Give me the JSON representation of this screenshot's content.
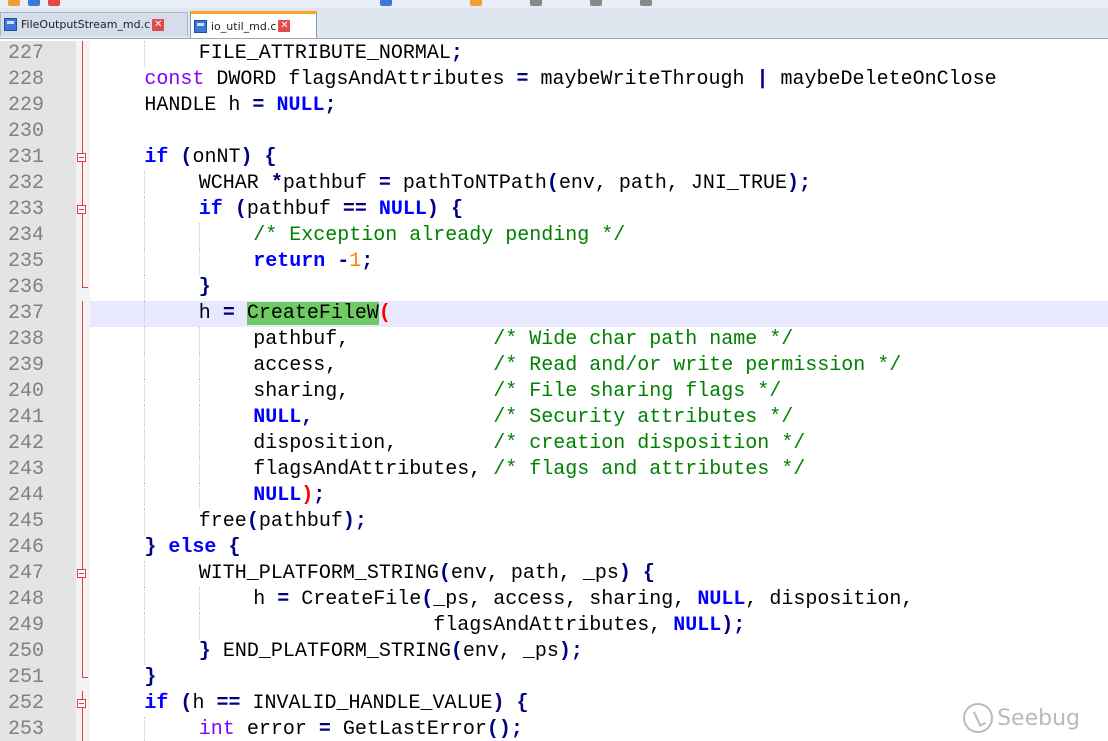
{
  "tabs": [
    {
      "label": "FileOutputStream_md.c",
      "active": false
    },
    {
      "label": "io_util_md.c",
      "active": true
    }
  ],
  "editor": {
    "highlight_line": "237",
    "lines": [
      {
        "num": "227",
        "fold": "bar",
        "indent": 4,
        "tokens": [
          {
            "t": "FILE_ATTRIBUTE_NORMAL",
            "c": "pl"
          },
          {
            "t": ";",
            "c": "op"
          }
        ]
      },
      {
        "num": "228",
        "fold": "bar",
        "indent": 2,
        "tokens": [
          {
            "t": "const",
            "c": "type"
          },
          {
            "t": " DWORD flagsAndAttributes ",
            "c": "pl"
          },
          {
            "t": "=",
            "c": "op"
          },
          {
            "t": " maybeWriteThrough ",
            "c": "pl"
          },
          {
            "t": "|",
            "c": "op"
          },
          {
            "t": " maybeDeleteOnClose",
            "c": "pl"
          }
        ]
      },
      {
        "num": "229",
        "fold": "bar",
        "indent": 2,
        "tokens": [
          {
            "t": "HANDLE h ",
            "c": "pl"
          },
          {
            "t": "=",
            "c": "op"
          },
          {
            "t": " ",
            "c": "pl"
          },
          {
            "t": "NULL",
            "c": "kw"
          },
          {
            "t": ";",
            "c": "op"
          }
        ]
      },
      {
        "num": "230",
        "fold": "bar",
        "indent": 0,
        "tokens": []
      },
      {
        "num": "231",
        "fold": "box",
        "indent": 2,
        "tokens": [
          {
            "t": "if",
            "c": "kw"
          },
          {
            "t": " ",
            "c": "pl"
          },
          {
            "t": "(",
            "c": "op"
          },
          {
            "t": "onNT",
            "c": "pl"
          },
          {
            "t": ")",
            "c": "op"
          },
          {
            "t": " ",
            "c": "pl"
          },
          {
            "t": "{",
            "c": "op"
          }
        ]
      },
      {
        "num": "232",
        "fold": "bar",
        "indent": 4,
        "tokens": [
          {
            "t": "WCHAR ",
            "c": "pl"
          },
          {
            "t": "*",
            "c": "op"
          },
          {
            "t": "pathbuf ",
            "c": "pl"
          },
          {
            "t": "=",
            "c": "op"
          },
          {
            "t": " pathToNTPath",
            "c": "pl"
          },
          {
            "t": "(",
            "c": "op"
          },
          {
            "t": "env, path, JNI_TRUE",
            "c": "pl"
          },
          {
            "t": ");",
            "c": "op"
          }
        ]
      },
      {
        "num": "233",
        "fold": "box",
        "indent": 4,
        "tokens": [
          {
            "t": "if",
            "c": "kw"
          },
          {
            "t": " ",
            "c": "pl"
          },
          {
            "t": "(",
            "c": "op"
          },
          {
            "t": "pathbuf ",
            "c": "pl"
          },
          {
            "t": "==",
            "c": "op"
          },
          {
            "t": " ",
            "c": "pl"
          },
          {
            "t": "NULL",
            "c": "kw"
          },
          {
            "t": ")",
            "c": "op"
          },
          {
            "t": " ",
            "c": "pl"
          },
          {
            "t": "{",
            "c": "op"
          }
        ]
      },
      {
        "num": "234",
        "fold": "bar",
        "indent": 6,
        "tokens": [
          {
            "t": "/* Exception already pending */",
            "c": "cm"
          }
        ]
      },
      {
        "num": "235",
        "fold": "bar",
        "indent": 6,
        "tokens": [
          {
            "t": "return",
            "c": "kw"
          },
          {
            "t": " ",
            "c": "pl"
          },
          {
            "t": "-",
            "c": "op"
          },
          {
            "t": "1",
            "c": "num"
          },
          {
            "t": ";",
            "c": "op"
          }
        ]
      },
      {
        "num": "236",
        "fold": "end",
        "indent": 4,
        "tokens": [
          {
            "t": "}",
            "c": "op"
          }
        ]
      },
      {
        "num": "237",
        "fold": "bar",
        "indent": 4,
        "tokens": [
          {
            "t": "h ",
            "c": "pl"
          },
          {
            "t": "=",
            "c": "op"
          },
          {
            "t": " ",
            "c": "pl"
          },
          {
            "t": "CreateFileW",
            "c": "match"
          },
          {
            "t": "(",
            "c": "red"
          }
        ]
      },
      {
        "num": "238",
        "fold": "bar",
        "indent": 6,
        "tokens": [
          {
            "t": "pathbuf,            ",
            "c": "pl"
          },
          {
            "t": "/* Wide char path name */",
            "c": "cm"
          }
        ]
      },
      {
        "num": "239",
        "fold": "bar",
        "indent": 6,
        "tokens": [
          {
            "t": "access,             ",
            "c": "pl"
          },
          {
            "t": "/* Read and/or write permission */",
            "c": "cm"
          }
        ]
      },
      {
        "num": "240",
        "fold": "bar",
        "indent": 6,
        "tokens": [
          {
            "t": "sharing,            ",
            "c": "pl"
          },
          {
            "t": "/* File sharing flags */",
            "c": "cm"
          }
        ]
      },
      {
        "num": "241",
        "fold": "bar",
        "indent": 6,
        "tokens": [
          {
            "t": "NULL",
            "c": "kw"
          },
          {
            "t": ",",
            "c": "op"
          },
          {
            "t": "               ",
            "c": "pl"
          },
          {
            "t": "/* Security attributes */",
            "c": "cm"
          }
        ]
      },
      {
        "num": "242",
        "fold": "bar",
        "indent": 6,
        "tokens": [
          {
            "t": "disposition,        ",
            "c": "pl"
          },
          {
            "t": "/* creation disposition */",
            "c": "cm"
          }
        ]
      },
      {
        "num": "243",
        "fold": "bar",
        "indent": 6,
        "tokens": [
          {
            "t": "flagsAndAttributes, ",
            "c": "pl"
          },
          {
            "t": "/* flags and attributes */",
            "c": "cm"
          }
        ]
      },
      {
        "num": "244",
        "fold": "bar",
        "indent": 6,
        "tokens": [
          {
            "t": "NULL",
            "c": "kw"
          },
          {
            "t": ")",
            "c": "red"
          },
          {
            "t": ";",
            "c": "op"
          }
        ]
      },
      {
        "num": "245",
        "fold": "bar",
        "indent": 4,
        "tokens": [
          {
            "t": "free",
            "c": "pl"
          },
          {
            "t": "(",
            "c": "op"
          },
          {
            "t": "pathbuf",
            "c": "pl"
          },
          {
            "t": ");",
            "c": "op"
          }
        ]
      },
      {
        "num": "246",
        "fold": "bar",
        "indent": 2,
        "tokens": [
          {
            "t": "}",
            "c": "op"
          },
          {
            "t": " ",
            "c": "pl"
          },
          {
            "t": "else",
            "c": "kw"
          },
          {
            "t": " ",
            "c": "pl"
          },
          {
            "t": "{",
            "c": "op"
          }
        ]
      },
      {
        "num": "247",
        "fold": "box",
        "indent": 4,
        "tokens": [
          {
            "t": "WITH_PLATFORM_STRING",
            "c": "pl"
          },
          {
            "t": "(",
            "c": "op"
          },
          {
            "t": "env, path, _ps",
            "c": "pl"
          },
          {
            "t": ")",
            "c": "op"
          },
          {
            "t": " ",
            "c": "pl"
          },
          {
            "t": "{",
            "c": "op"
          }
        ]
      },
      {
        "num": "248",
        "fold": "bar",
        "indent": 6,
        "tokens": [
          {
            "t": "h ",
            "c": "pl"
          },
          {
            "t": "=",
            "c": "op"
          },
          {
            "t": " CreateFile",
            "c": "pl"
          },
          {
            "t": "(",
            "c": "op"
          },
          {
            "t": "_ps, access, sharing, ",
            "c": "pl"
          },
          {
            "t": "NULL",
            "c": "kw"
          },
          {
            "t": ", disposition,",
            "c": "pl"
          }
        ]
      },
      {
        "num": "249",
        "fold": "bar",
        "indent": 6,
        "tokens": [
          {
            "t": "               flagsAndAttributes, ",
            "c": "pl"
          },
          {
            "t": "NULL",
            "c": "kw"
          },
          {
            "t": ");",
            "c": "op"
          }
        ]
      },
      {
        "num": "250",
        "fold": "bar",
        "indent": 4,
        "tokens": [
          {
            "t": "}",
            "c": "op"
          },
          {
            "t": " END_PLATFORM_STRING",
            "c": "pl"
          },
          {
            "t": "(",
            "c": "op"
          },
          {
            "t": "env, _ps",
            "c": "pl"
          },
          {
            "t": ");",
            "c": "op"
          }
        ]
      },
      {
        "num": "251",
        "fold": "end",
        "indent": 2,
        "tokens": [
          {
            "t": "}",
            "c": "op"
          }
        ]
      },
      {
        "num": "252",
        "fold": "box",
        "indent": 2,
        "tokens": [
          {
            "t": "if",
            "c": "kw"
          },
          {
            "t": " ",
            "c": "pl"
          },
          {
            "t": "(",
            "c": "op"
          },
          {
            "t": "h ",
            "c": "pl"
          },
          {
            "t": "==",
            "c": "op"
          },
          {
            "t": " INVALID_HANDLE_VALUE",
            "c": "pl"
          },
          {
            "t": ")",
            "c": "op"
          },
          {
            "t": " ",
            "c": "pl"
          },
          {
            "t": "{",
            "c": "op"
          }
        ]
      },
      {
        "num": "253",
        "fold": "bar",
        "indent": 4,
        "tokens": [
          {
            "t": "int",
            "c": "type"
          },
          {
            "t": " error ",
            "c": "pl"
          },
          {
            "t": "=",
            "c": "op"
          },
          {
            "t": " GetLastError",
            "c": "pl"
          },
          {
            "t": "();",
            "c": "op"
          }
        ]
      }
    ]
  },
  "watermark": {
    "text": "Seebug"
  }
}
